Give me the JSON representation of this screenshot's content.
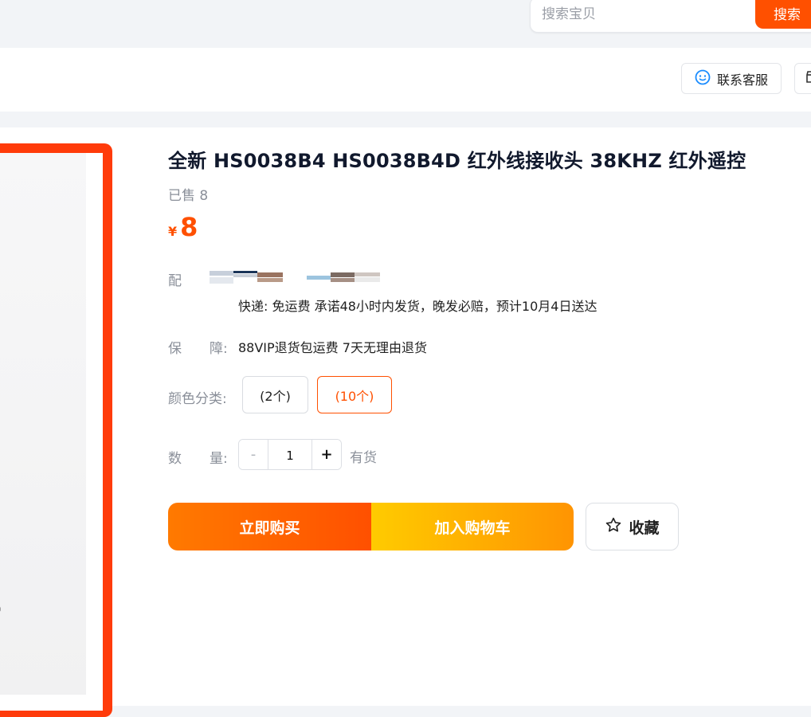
{
  "search": {
    "placeholder": "搜索宝贝",
    "button_label": "搜索"
  },
  "store_bar": {
    "service_label": "联系客服",
    "service_icon": "smile-service-icon",
    "extra_icon": "shop-icon"
  },
  "product": {
    "title": "全新 HS0038B4 HS0038B4D 红外线接收头 38KHZ 红外遥控",
    "sold": "已售 8",
    "price_currency": "¥",
    "price_amount": "8",
    "delivery_label": "配",
    "shipping": "快递: 免运费  承诺48小时内发货，晚发必赔，预计10月4日送达",
    "guarantee_label_1": "保",
    "guarantee_label_2": "障:",
    "guarantee": "88VIP退货包运费 7天无理由退货",
    "color_label": "颜色分类:",
    "sku_options": [
      "(2个)",
      "(10个)"
    ],
    "selected_sku": "(10个)",
    "qty_label_1": "数",
    "qty_label_2": "量:",
    "qty_minus": "-",
    "qty_value": "1",
    "qty_plus": "+",
    "stock": "有货"
  },
  "actions": {
    "buy_now": "立即购买",
    "add_to_cart": "加入购物车",
    "favorite": "收藏"
  },
  "colors": {
    "accent": "#ff5000",
    "price": "#ff5000",
    "buy_now_gradient": [
      "#ff7a00",
      "#ff5000"
    ],
    "cart_gradient": [
      "#ffcb00",
      "#ff9402"
    ]
  }
}
